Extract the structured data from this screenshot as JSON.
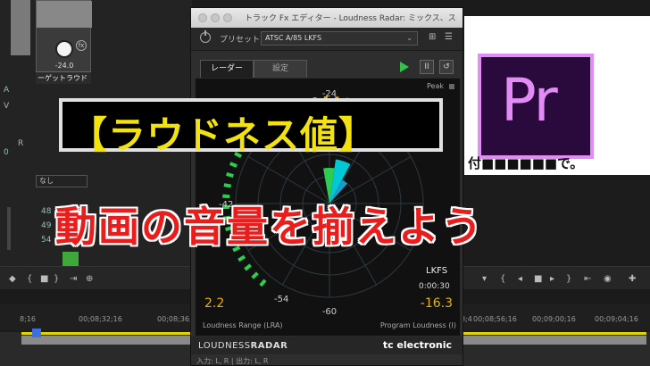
{
  "left_panel": {
    "knob_value": "-24.0",
    "target_label": "ーゲットラウド",
    "fx_badge": "fx",
    "select_value": "なし",
    "fragments": {
      "r_label": "R",
      "num_a": "0",
      "num_b": "48",
      "num_c": "49",
      "num_d": "54",
      "letter_a": "A",
      "letter_b": "V"
    }
  },
  "plugin": {
    "window_title": "トラック Fx エディター - Loudness Radar: ミックス、スロット 1",
    "preset_label": "プリセット:",
    "preset_value": "ATSC A/85 LKFS",
    "tabs": [
      "レーダー",
      "設定"
    ],
    "peak_label": "Peak",
    "radar_scale": {
      "top": "-24",
      "left": "-42",
      "bottom_left": "-54",
      "bottom": "-60"
    },
    "lkfs_label": "LKFS",
    "time": "0:00:30",
    "lra_value": "2.2",
    "lra_label": "Loudness Range (LRA)",
    "program_loudness_value": "-16.3",
    "program_loudness_label": "Program Loudness (I)",
    "logo_left_a": "LOUDNESS",
    "logo_left_b": "RADAR",
    "logo_right": "tc electronic",
    "io_label": "入力: L, R | 出力: L, R",
    "colors": {
      "accent": "#e8b400",
      "play": "#36c24a",
      "radar_green": "#2ecc50",
      "radar_cyan": "#00c8d6"
    }
  },
  "right": {
    "pr_text": "Pr",
    "caption_fragment": "付■■■■■■で。",
    "colors": {
      "pr_border": "#e28cf5",
      "pr_bg": "#2a0a3d"
    }
  },
  "timeline": {
    "ruler": [
      "8;16",
      "00;08;32;16",
      "00;08;36;16",
      "00;08;4",
      "00;08;56;16",
      "00;09;00;16",
      "00;09;04;16"
    ],
    "transport_icons": [
      "marker-icon",
      "step-back-icon",
      "stop-icon",
      "step-forward-icon",
      "plus-icon"
    ]
  },
  "overlay": {
    "title": "【ラウドネス値】",
    "subtitle": "動画の音量を揃えよう",
    "colors": {
      "title": "#f2e20f",
      "subtitle": "#ea1d1d"
    }
  }
}
